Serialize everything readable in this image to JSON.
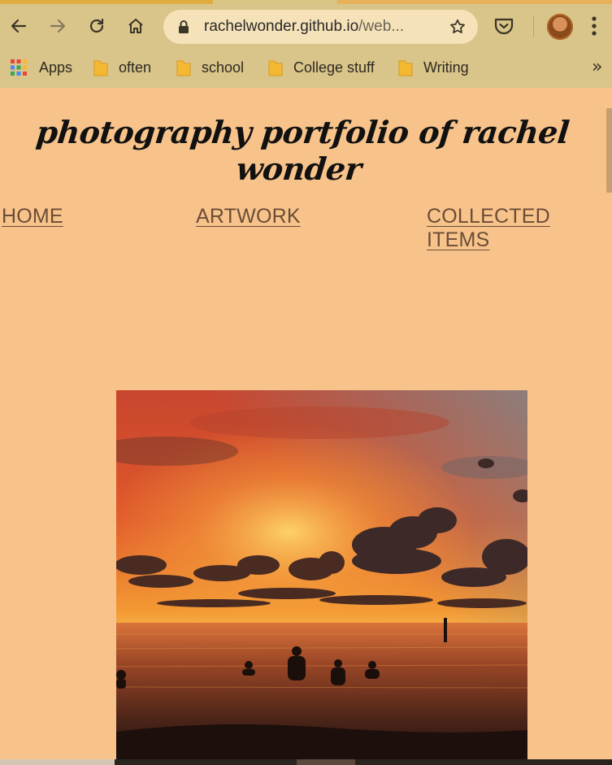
{
  "browser": {
    "url_host": "rachelwonder.github.io",
    "url_path": "/web...",
    "bookmarks": [
      {
        "label": "Apps",
        "icon": "apps-grid-icon"
      },
      {
        "label": "often",
        "icon": "folder-icon"
      },
      {
        "label": "school",
        "icon": "folder-icon"
      },
      {
        "label": "College stuff",
        "icon": "folder-icon"
      },
      {
        "label": "Writing",
        "icon": "folder-icon"
      }
    ],
    "more_label": "»"
  },
  "page": {
    "title": "photography portfolio of rachel wonder",
    "nav": [
      {
        "label": "HOME"
      },
      {
        "label": "ARTWORK"
      },
      {
        "label": "COLLECTED ITEMS"
      }
    ]
  },
  "colors": {
    "page_background": "#f8c38a",
    "chrome_background": "#d9c48a",
    "nav_link": "#6b4d37"
  }
}
